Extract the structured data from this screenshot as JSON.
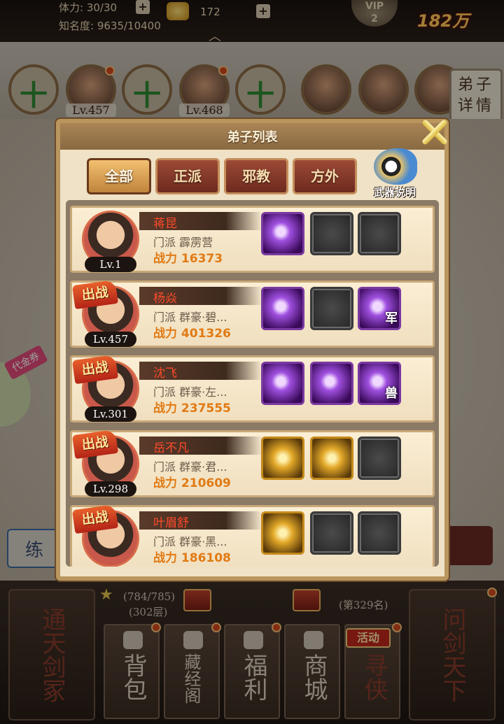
{
  "top_bar": {
    "stamina_label": "体力: 30/30",
    "fame_label": "知名度: 9635/10400",
    "gold_amount": "172",
    "vip_label": "VIP",
    "vip_level": "2",
    "power_value": "182万"
  },
  "team": {
    "slots": [
      {
        "type": "empty"
      },
      {
        "type": "hero",
        "level": "Lv.457"
      },
      {
        "type": "empty"
      },
      {
        "type": "hero",
        "level": "Lv.468"
      },
      {
        "type": "empty"
      },
      {
        "type": "hero"
      },
      {
        "type": "hero"
      },
      {
        "type": "hero"
      }
    ],
    "detail_button": "弟子详情"
  },
  "side": {
    "coupon_label": "代金券",
    "practice_label": "练"
  },
  "modal": {
    "title": "弟子列表",
    "tabs": [
      "全部",
      "正派",
      "邪教",
      "方外"
    ],
    "active_tab": "全部",
    "weapon_info_label": "武器说明",
    "disciples": [
      {
        "name": "蒋昆",
        "level": "Lv.1",
        "deployed": false,
        "sect": "门派  霹雳营",
        "power": "战力 16373",
        "skills": [
          {
            "style": "purple",
            "tag": ""
          },
          {
            "style": "empty",
            "tag": ""
          },
          {
            "style": "empty",
            "tag": ""
          }
        ]
      },
      {
        "name": "杨焱",
        "level": "Lv.457",
        "deployed": true,
        "sect": "门派  群豪·碧...",
        "power": "战力 401326",
        "skills": [
          {
            "style": "purple",
            "tag": ""
          },
          {
            "style": "empty",
            "tag": ""
          },
          {
            "style": "purple",
            "tag": "军"
          }
        ]
      },
      {
        "name": "沈飞",
        "level": "Lv.301",
        "deployed": true,
        "sect": "门派  群豪·左...",
        "power": "战力 237555",
        "skills": [
          {
            "style": "purple",
            "tag": ""
          },
          {
            "style": "purple",
            "tag": ""
          },
          {
            "style": "purple",
            "tag": "兽"
          }
        ]
      },
      {
        "name": "岳不凡",
        "level": "Lv.298",
        "deployed": true,
        "sect": "门派  群豪·君...",
        "power": "战力 210609",
        "skills": [
          {
            "style": "gold",
            "tag": ""
          },
          {
            "style": "gold",
            "tag": ""
          },
          {
            "style": "empty",
            "tag": ""
          }
        ]
      },
      {
        "name": "叶眉舒",
        "level": "",
        "deployed": true,
        "sect": "门派  群豪·黑...",
        "power": "战力 186108",
        "skills": [
          {
            "style": "gold",
            "tag": ""
          },
          {
            "style": "empty",
            "tag": ""
          },
          {
            "style": "empty",
            "tag": ""
          }
        ]
      }
    ],
    "deploy_label": "出战"
  },
  "bottom": {
    "tower_progress": "(784/785)",
    "tower_floor": "(302层)",
    "rank": "(第329名)",
    "nav_left": "通天剑冢",
    "nav_items": [
      "背包",
      "藏经阁",
      "福利",
      "商城",
      "寻侠"
    ],
    "nav_right": "问剑天下",
    "activity_tag": "活动"
  }
}
